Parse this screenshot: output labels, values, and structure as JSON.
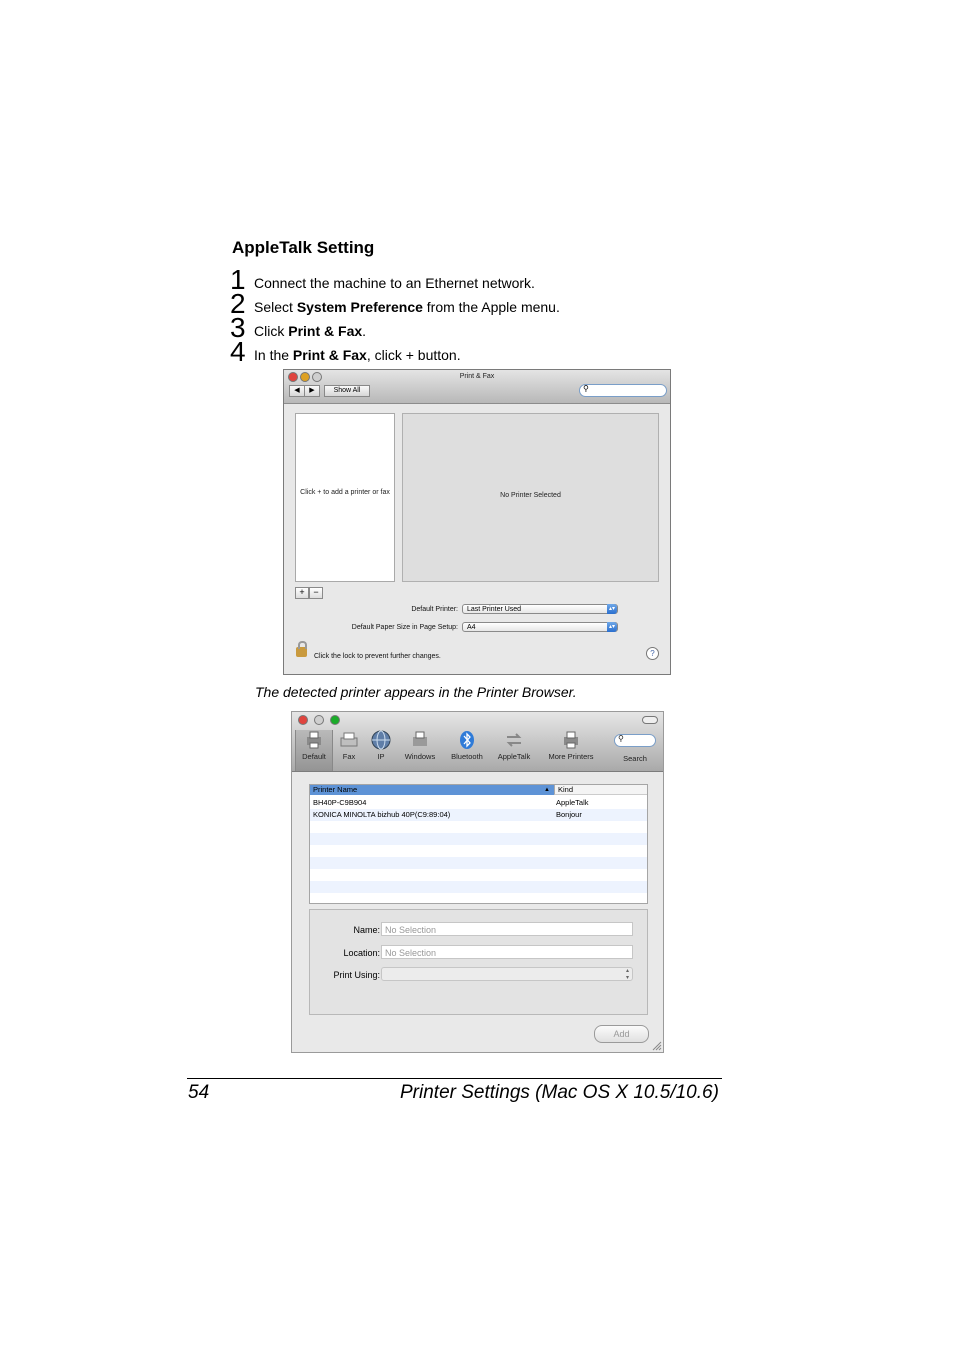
{
  "heading": "AppleTalk Setting",
  "steps": [
    {
      "num": "1",
      "parts": [
        "Connect the machine to an Ethernet network.",
        "",
        ""
      ]
    },
    {
      "num": "2",
      "parts": [
        "Select ",
        "System Preference",
        " from the Apple menu."
      ]
    },
    {
      "num": "3",
      "parts": [
        "Click ",
        "Print & Fax",
        "."
      ]
    },
    {
      "num": "4",
      "parts": [
        "In the ",
        "Print & Fax",
        ", click + button."
      ]
    }
  ],
  "print_fax": {
    "title": "Print & Fax",
    "show_all": "Show All",
    "add_hint": "Click + to add a printer or fax",
    "no_printer": "No Printer Selected",
    "plus": "+",
    "minus": "−",
    "default_printer_label": "Default Printer:",
    "default_printer_value": "Last Printer Used",
    "paper_size_label": "Default Paper Size in Page Setup:",
    "paper_size_value": "A4",
    "lock_text": "Click the lock to prevent further changes.",
    "help": "?"
  },
  "caption": "The detected printer appears in the Printer Browser.",
  "browser": {
    "toolbar": [
      "Default",
      "Fax",
      "IP",
      "Windows",
      "Bluetooth",
      "AppleTalk",
      "More Printers",
      "Search"
    ],
    "col_name": "Printer Name",
    "col_kind": "Kind",
    "rows": [
      {
        "name": "BH40P-C9B904",
        "kind": "AppleTalk"
      },
      {
        "name": "KONICA MINOLTA bizhub 40P(C9:89:04)",
        "kind": "Bonjour"
      }
    ],
    "name_label": "Name:",
    "name_value": "No Selection",
    "location_label": "Location:",
    "location_value": "No Selection",
    "print_using_label": "Print Using:",
    "add_button": "Add"
  },
  "footer": {
    "page_number": "54",
    "section_title": "Printer Settings (Mac OS X 10.5/10.6)"
  },
  "colors": {
    "selection_blue": "#5e93d6",
    "stripe": "#edf3fe",
    "close_red": "#e0443e",
    "min_yellow": "#dea123",
    "zoom_green": "#1aab29"
  }
}
